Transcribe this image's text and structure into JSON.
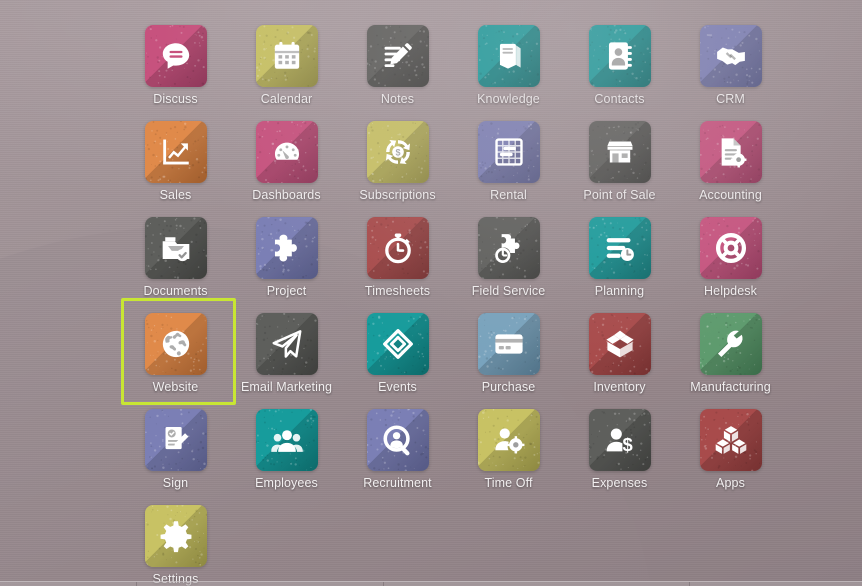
{
  "desktop": {
    "background_color": "#9c8b8f",
    "highlight_color": "#c8e633",
    "label_color": "#f2eff0"
  },
  "app_grid": {
    "columns": 6,
    "apps": [
      {
        "label": "Discuss",
        "icon": "chat-bubble-icon",
        "color": "#c7527e",
        "dark": "#a83f68"
      },
      {
        "label": "Calendar",
        "icon": "calendar-icon",
        "color": "#c8c264",
        "dark": "#a8a24d"
      },
      {
        "label": "Notes",
        "icon": "note-pencil-icon",
        "color": "#5e5f5c",
        "dark": "#4a4b48"
      },
      {
        "label": "Knowledge",
        "icon": "book-icon",
        "color": "#179c9c",
        "dark": "#0f7e7e"
      },
      {
        "label": "Contacts",
        "icon": "address-book-icon",
        "color": "#179c9c",
        "dark": "#0f7e7e"
      },
      {
        "label": "CRM",
        "icon": "handshake-icon",
        "color": "#7b7fb5",
        "dark": "#656a9e"
      },
      {
        "label": "Sales",
        "icon": "chart-arrow-up-icon",
        "color": "#e08a4a",
        "dark": "#bf6f35"
      },
      {
        "label": "Dashboards",
        "icon": "gauge-icon",
        "color": "#c7527e",
        "dark": "#a83f68"
      },
      {
        "label": "Subscriptions",
        "icon": "recycle-dollar-icon",
        "color": "#c8c264",
        "dark": "#a8a24d"
      },
      {
        "label": "Rental",
        "icon": "gantt-grid-icon",
        "color": "#7b7fb5",
        "dark": "#656a9e"
      },
      {
        "label": "Point of Sale",
        "icon": "shop-icon",
        "color": "#5e5f5c",
        "dark": "#4a4b48"
      },
      {
        "label": "Accounting",
        "icon": "invoice-gear-icon",
        "color": "#c7527e",
        "dark": "#a83f68"
      },
      {
        "label": "Documents",
        "icon": "file-box-check-icon",
        "color": "#5e5f5c",
        "dark": "#4a4b48"
      },
      {
        "label": "Project",
        "icon": "puzzle-icon",
        "color": "#7b7fb5",
        "dark": "#656a9e"
      },
      {
        "label": "Timesheets",
        "icon": "stopwatch-icon",
        "color": "#a84b4b",
        "dark": "#8c3a3a"
      },
      {
        "label": "Field Service",
        "icon": "puzzle-clock-icon",
        "color": "#5e5f5c",
        "dark": "#4a4b48"
      },
      {
        "label": "Planning",
        "icon": "list-clock-icon",
        "color": "#179c9c",
        "dark": "#0f7e7e"
      },
      {
        "label": "Helpdesk",
        "icon": "life-ring-icon",
        "color": "#c7527e",
        "dark": "#a83f68"
      },
      {
        "label": "Website",
        "icon": "globe-icon",
        "color": "#e08a4a",
        "dark": "#bf6f35",
        "selected": true
      },
      {
        "label": "Email Marketing",
        "icon": "paper-plane-icon",
        "color": "#5e5f5c",
        "dark": "#4a4b48"
      },
      {
        "label": "Events",
        "icon": "ticket-icon",
        "color": "#179c9c",
        "dark": "#0f7e7e"
      },
      {
        "label": "Purchase",
        "icon": "credit-card-icon",
        "color": "#79a3bd",
        "dark": "#6189a3"
      },
      {
        "label": "Inventory",
        "icon": "open-box-icon",
        "color": "#a84b4b",
        "dark": "#8c3a3a"
      },
      {
        "label": "Manufacturing",
        "icon": "wrench-icon",
        "color": "#5e9b6e",
        "dark": "#468057"
      },
      {
        "label": "Sign",
        "icon": "signature-icon",
        "color": "#7b7fb5",
        "dark": "#656a9e"
      },
      {
        "label": "Employees",
        "icon": "people-group-icon",
        "color": "#179c9c",
        "dark": "#0f7e7e"
      },
      {
        "label": "Recruitment",
        "icon": "person-search-icon",
        "color": "#7b7fb5",
        "dark": "#656a9e"
      },
      {
        "label": "Time Off",
        "icon": "person-gear-icon",
        "color": "#c8c264",
        "dark": "#a8a24d"
      },
      {
        "label": "Expenses",
        "icon": "person-dollar-icon",
        "color": "#5e5f5c",
        "dark": "#4a4b48"
      },
      {
        "label": "Apps",
        "icon": "blocks-icon",
        "color": "#a84b4b",
        "dark": "#8c3a3a"
      },
      {
        "label": "Settings",
        "icon": "gear-icon",
        "color": "#c8c264",
        "dark": "#a8a24d"
      }
    ]
  }
}
